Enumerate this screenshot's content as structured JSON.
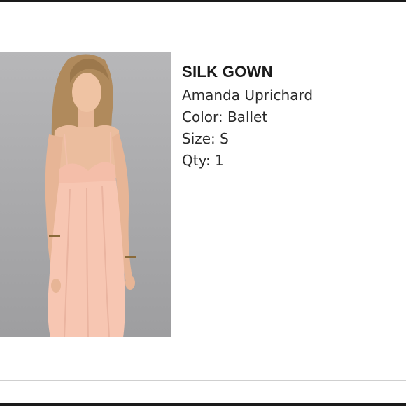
{
  "product": {
    "title": "SILK GOWN",
    "brand": "Amanda Uprichard",
    "color": "Color: Ballet",
    "size": "Size: S",
    "quantity": "Qty: 1"
  },
  "colors": {
    "dress": "#f6c3af",
    "background": "#a9a9ab",
    "frame": "#1a1a1a"
  }
}
